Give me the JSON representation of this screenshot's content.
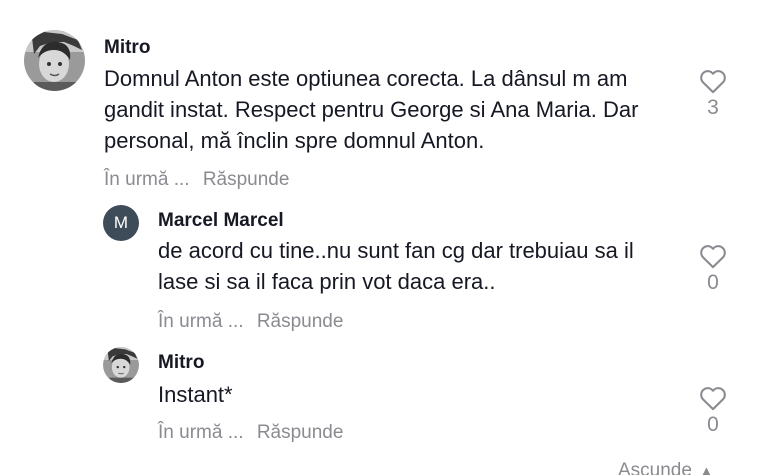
{
  "comments": [
    {
      "username": "Mitro",
      "text": "Domnul Anton este optiunea corecta. La dânsul m am gandit instat. Respect pentru George si Ana Maria. Dar personal, mă înclin spre domnul Anton.",
      "time": "În urmă ...",
      "reply_label": "Răspunde",
      "likes": "3",
      "avatar_icon": "photo-avatar-icon"
    },
    {
      "username": "Marcel Marcel",
      "avatar_letter": "M",
      "text": "de acord cu tine..nu sunt fan cg dar trebuiau sa il lase si sa il faca prin vot daca era..",
      "time": "În urmă ...",
      "reply_label": "Răspunde",
      "likes": "0",
      "avatar_color": "#3e4b58"
    },
    {
      "username": "Mitro",
      "text": "Instant*",
      "time": "În urmă ...",
      "reply_label": "Răspunde",
      "likes": "0",
      "avatar_icon": "photo-avatar-icon"
    }
  ],
  "hide_replies_label": "Ascunde",
  "colors": {
    "text": "#161823",
    "muted": "#8a8b91"
  }
}
